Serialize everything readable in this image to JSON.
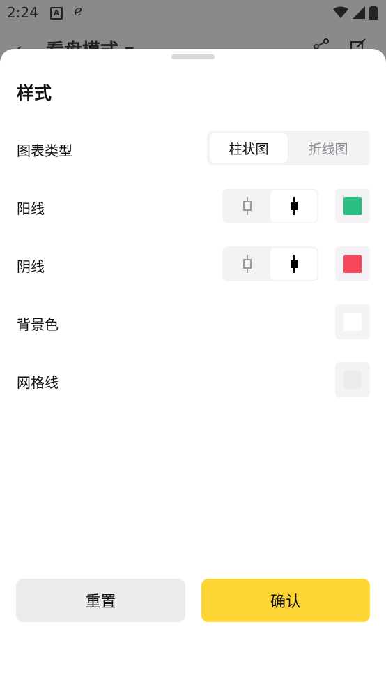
{
  "status": {
    "time": "2:24"
  },
  "underlying": {
    "title": "看盘模式 ▾"
  },
  "sheet": {
    "title": "样式",
    "chart_type": {
      "label": "图表类型",
      "options": [
        "柱状图",
        "折线图"
      ],
      "selected": "柱状图"
    },
    "up_line": {
      "label": "阳线",
      "style_selected": "solid",
      "color": "#2dbe84"
    },
    "down_line": {
      "label": "阴线",
      "style_selected": "solid",
      "color": "#f4475a"
    },
    "background": {
      "label": "背景色",
      "color": "#ffffff"
    },
    "grid": {
      "label": "网格线",
      "color": "#ececec"
    }
  },
  "buttons": {
    "reset": "重置",
    "confirm": "确认"
  },
  "colors": {
    "accent": "#fdd535",
    "segment_bg": "#f3f3f5"
  }
}
